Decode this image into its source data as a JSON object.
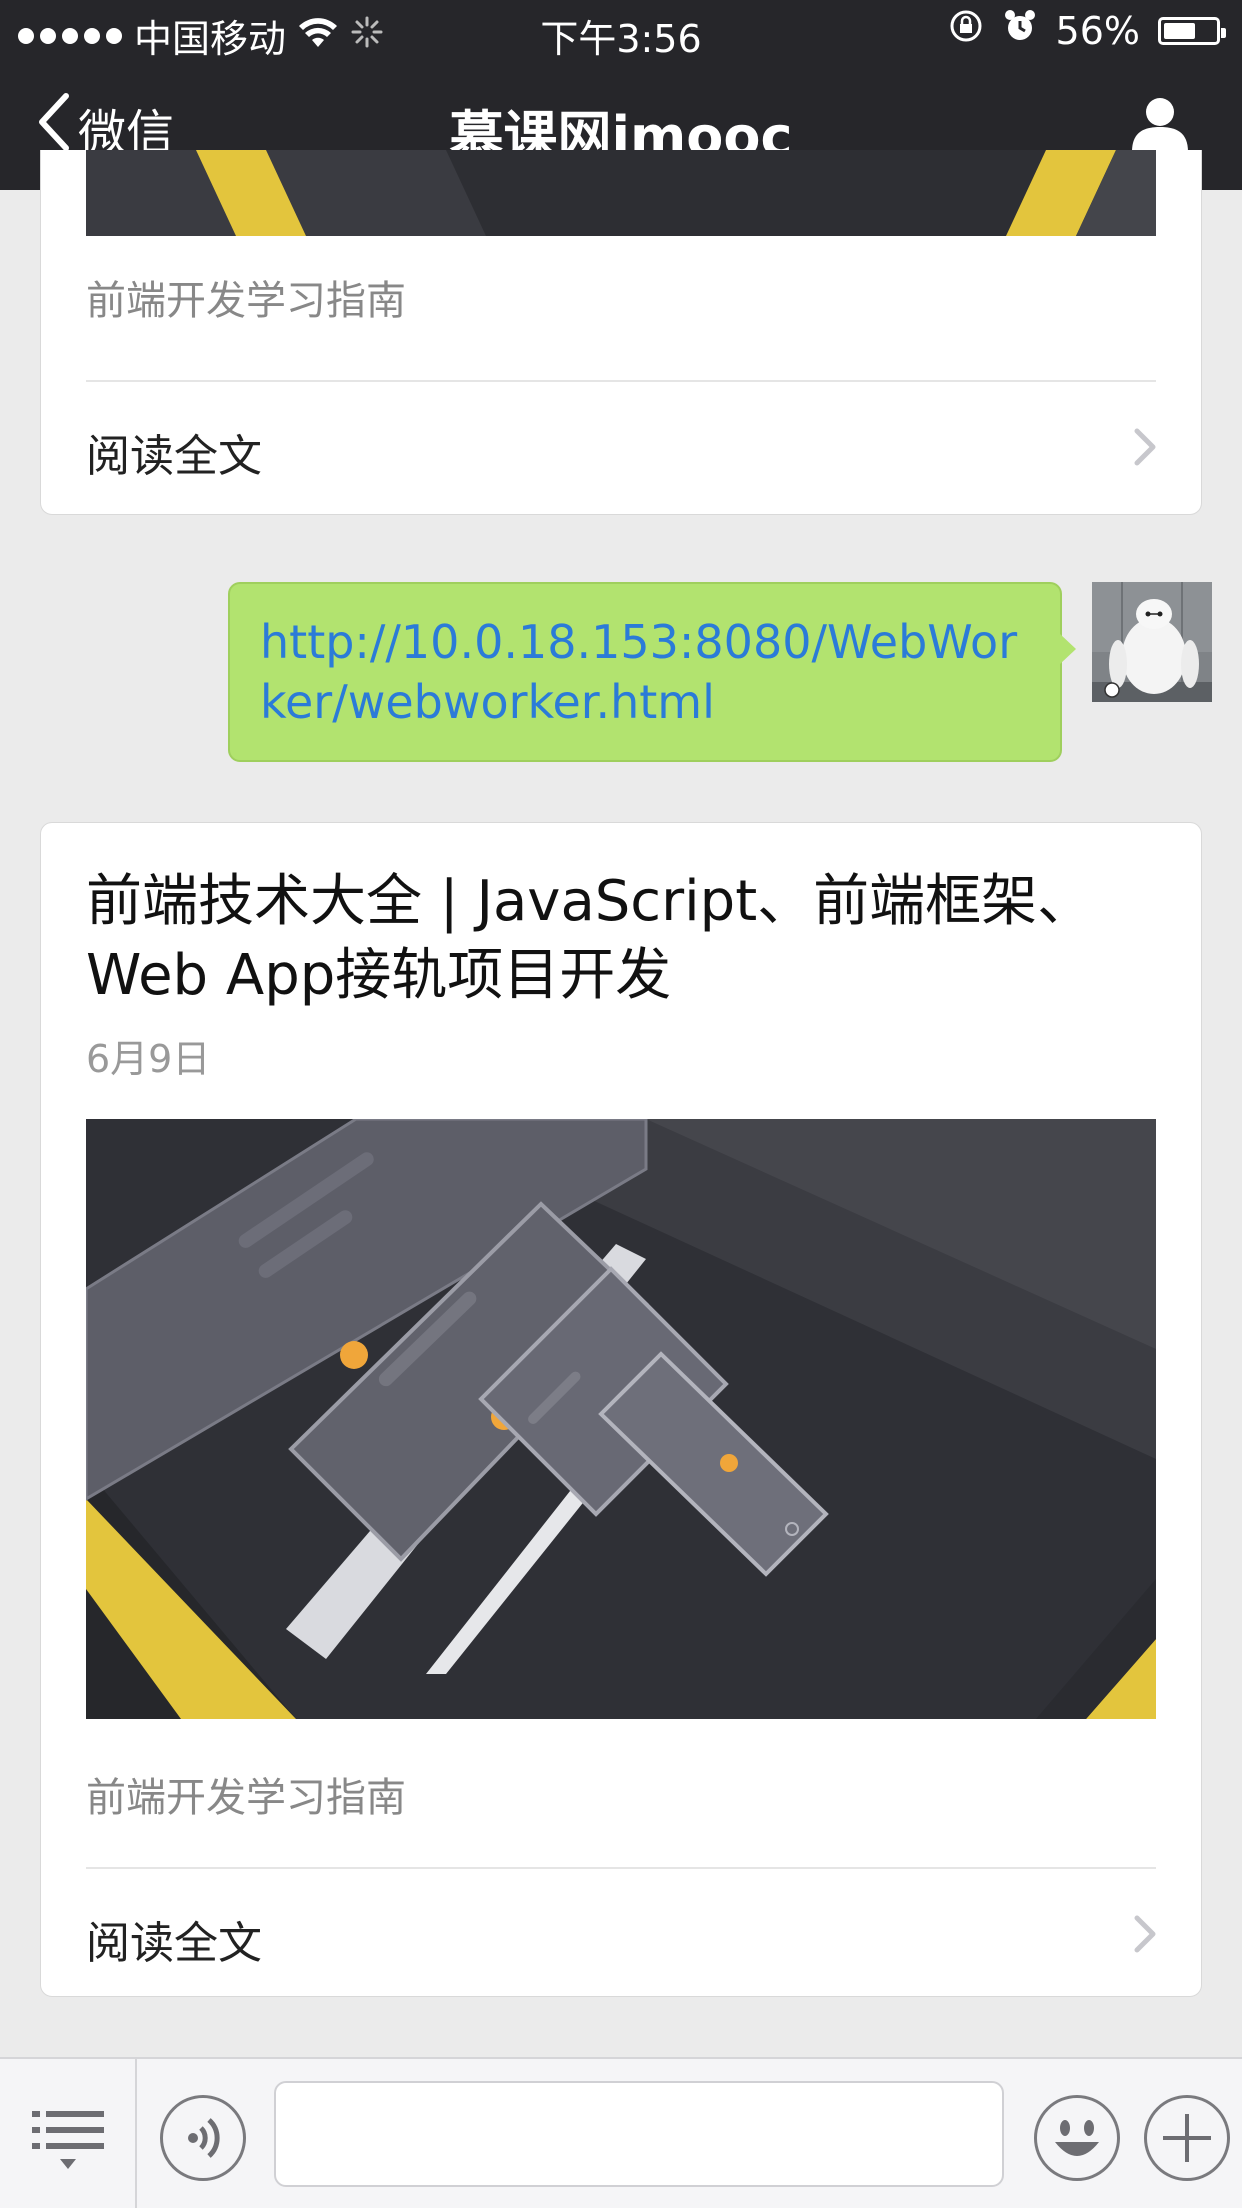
{
  "status_bar": {
    "carrier": "中国移动",
    "time": "下午3:56",
    "battery_percent": "56%",
    "battery_level": 0.56
  },
  "nav": {
    "back_label": "微信",
    "title": "慕课网imooc"
  },
  "messages": [
    {
      "type": "article-card",
      "description": "前端开发学习指南",
      "read_label": "阅读全文"
    },
    {
      "type": "link-bubble",
      "text": "http://10.0.18.153:8080/WebWorker/webworker.html"
    },
    {
      "type": "article-card",
      "title": "前端技术大全 | JavaScript、前端框架、Web App接轨项目开发",
      "date": "6月9日",
      "description": "前端开发学习指南",
      "read_label": "阅读全文"
    }
  ],
  "input_bar": {
    "input_value": ""
  },
  "icons": {
    "back": "chevron-left-icon",
    "profile": "person-icon",
    "wifi": "wifi-icon",
    "alarm": "alarm-icon",
    "rotation_lock": "rotation-lock-icon",
    "battery": "battery-icon",
    "menu": "menu-list-icon",
    "voice": "voice-icon",
    "emoji": "emoji-icon",
    "plus": "plus-icon"
  },
  "colors": {
    "nav_bg": "#26262a",
    "bubble_bg": "#b2e36f",
    "link_text": "#2b7bd8",
    "accent_yellow": "#e3c53d"
  }
}
